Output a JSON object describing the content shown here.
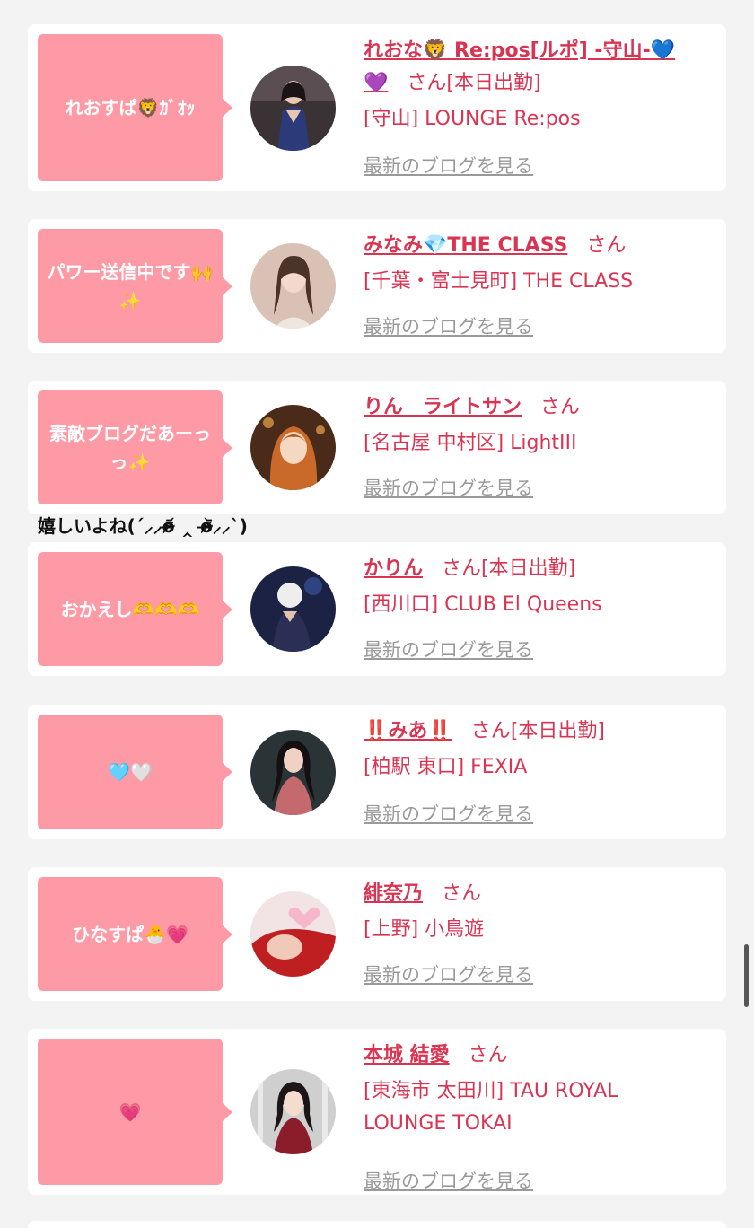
{
  "entries": [
    {
      "bubble": "れおすぱ🦁ｶﾞｵｯ",
      "name": "れおな🦁 Re:pos[ルポ] -守山-💙💜",
      "san": "さん",
      "status": "[本日出勤]",
      "shop": "[守山] LOUNGE Re:pos",
      "blog": "最新のブログを見る"
    },
    {
      "bubble": "パワー送信中です🙌✨",
      "name": "みなみ💎THE CLASS",
      "san": "さん",
      "status": "",
      "shop": "[千葉・富士見町] THE CLASS",
      "blog": "最新のブログを見る"
    },
    {
      "bubble": "素敵ブログだあーっっ✨",
      "name": "りん　ライトサン",
      "san": "さん",
      "status": "",
      "shop": "[名古屋 中村区] LightIII",
      "blog": "最新のブログを見る"
    },
    {
      "bubble": "おかえし🫶🫶🫶",
      "name": "かりん",
      "san": "さん",
      "status": "[本日出勤]",
      "shop": "[西川口] CLUB El Queens",
      "blog": "最新のブログを見る"
    },
    {
      "bubble": "🩵🤍",
      "name": "‼️みあ‼️",
      "san": "さん",
      "status": "[本日出勤]",
      "shop": "[柏駅 東口] FEXIA",
      "blog": "最新のブログを見る"
    },
    {
      "bubble": "ひなすぱ🐣💗",
      "name": "緋奈乃",
      "san": "さん",
      "status": "",
      "shop": "[上野] 小鳥遊",
      "blog": "最新のブログを見る"
    },
    {
      "bubble": "💗",
      "name": "本城 結愛",
      "san": "さん",
      "status": "",
      "shop": "[東海市 太田川] TAU ROYAL LOUNGE TOKAI",
      "blog": "最新のブログを見る"
    }
  ],
  "comment_between": "嬉しいよね(ˊ⸝⸝o̴̶̷᷄ ‸ o̴̶̷᷅⸝⸝ˋ)",
  "colors": {
    "accent": "#d93553",
    "bubble": "#fd9aa6",
    "link_gray": "#9a9a9a",
    "background": "#f3f3f3"
  },
  "avatar_icons": [
    "avatar-photo-icon",
    "avatar-photo-icon",
    "avatar-illustration-icon",
    "avatar-photo-icon",
    "avatar-photo-icon",
    "avatar-photo-icon",
    "avatar-photo-icon"
  ]
}
